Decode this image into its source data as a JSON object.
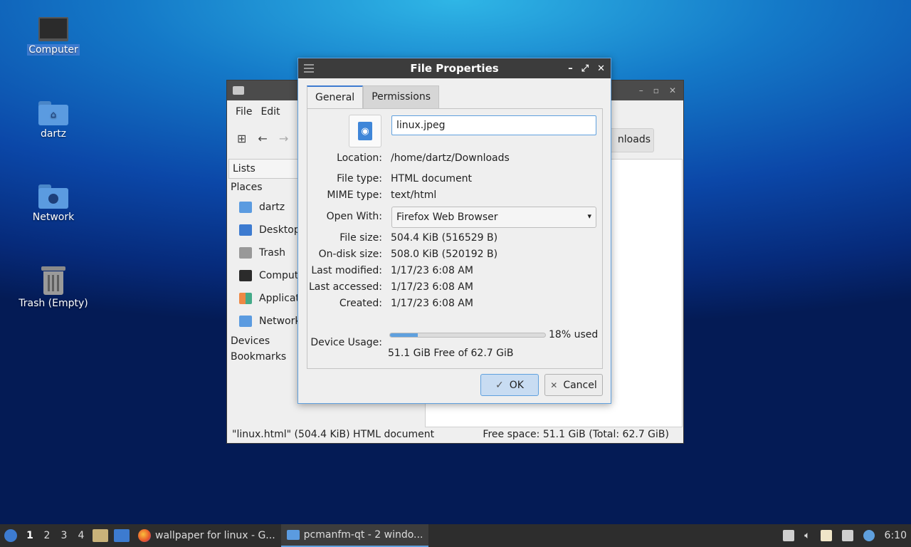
{
  "desktop": {
    "icons": [
      {
        "label": "Computer"
      },
      {
        "label": "dartz"
      },
      {
        "label": "Network"
      },
      {
        "label": "Trash (Empty)"
      }
    ]
  },
  "file_manager": {
    "menu": [
      "File",
      "Edit"
    ],
    "path_fragment": "nloads",
    "side_pane_mode": "Lists",
    "sections": {
      "places": "Places",
      "devices": "Devices",
      "bookmarks": "Bookmarks"
    },
    "places": [
      "dartz",
      "Desktop",
      "Trash",
      "Computer",
      "Applications",
      "Network"
    ],
    "status_left": "\"linux.html\" (504.4 KiB) HTML document",
    "status_right": "Free space: 51.1 GiB (Total: 62.7 GiB)"
  },
  "dialog": {
    "title": "File Properties",
    "tabs": [
      "General",
      "Permissions"
    ],
    "filename": "linux.jpeg",
    "labels": {
      "location": "Location:",
      "file_type": "File type:",
      "mime_type": "MIME type:",
      "open_with": "Open With:",
      "file_size": "File size:",
      "on_disk_size": "On-disk size:",
      "last_modified": "Last modified:",
      "last_accessed": "Last accessed:",
      "created": "Created:",
      "device_usage": "Device Usage:"
    },
    "values": {
      "location": "/home/dartz/Downloads",
      "file_type": "HTML document",
      "mime_type": "text/html",
      "open_with": "Firefox Web Browser",
      "file_size": "504.4 KiB (516529 B)",
      "on_disk_size": "508.0 KiB (520192 B)",
      "last_modified": "1/17/23 6:08 AM",
      "last_accessed": "1/17/23 6:08 AM",
      "created": "1/17/23 6:08 AM"
    },
    "usage": {
      "percent": 18,
      "percent_text": "18% used",
      "free_text": "51.1 GiB Free of 62.7 GiB"
    },
    "buttons": {
      "ok": "OK",
      "cancel": "Cancel"
    }
  },
  "taskbar": {
    "workspaces": [
      "1",
      "2",
      "3",
      "4"
    ],
    "tasks": [
      "wallpaper for linux - G...",
      "pcmanfm-qt - 2 windo..."
    ],
    "clock": "6:10"
  },
  "colors": {
    "accent": "#3d7bd0",
    "highlight": "#5fa0de",
    "taskbar": "#2d2d2d"
  }
}
